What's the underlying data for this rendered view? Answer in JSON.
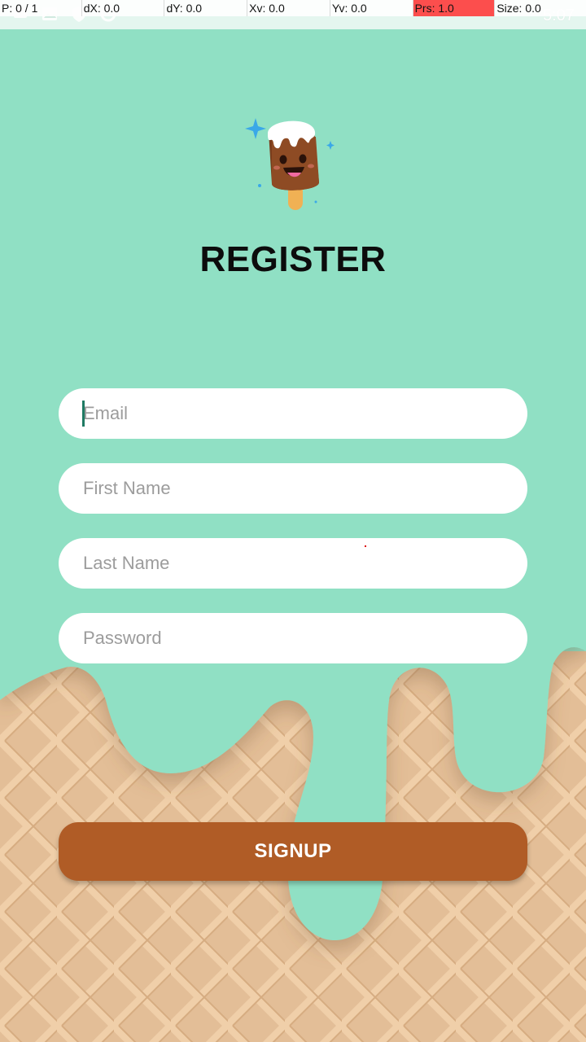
{
  "debug_overlay": {
    "pointer": "P: 0 / 1",
    "dx": "dX: 0.0",
    "dy": "dY: 0.0",
    "xv": "Xv: 0.0",
    "yv": "Yv: 0.0",
    "prs": "Prs: 1.0",
    "size": "Size: 0.0"
  },
  "status_bar": {
    "time": "5:07",
    "icons": [
      "notification-icon",
      "image-icon",
      "shield-icon",
      "sync-icon"
    ]
  },
  "colors": {
    "background_mint": "#90e0c4",
    "waffle": "#e4bf98",
    "signup_button": "#b05c26",
    "title": "#0c0c0c"
  },
  "logo": {
    "icon": "popsicle-icon"
  },
  "register": {
    "title": "REGISTER",
    "email_placeholder": "Email",
    "first_name_placeholder": "First Name",
    "last_name_placeholder": "Last Name",
    "password_placeholder": "Password",
    "signup_label": "SIGNUP"
  }
}
